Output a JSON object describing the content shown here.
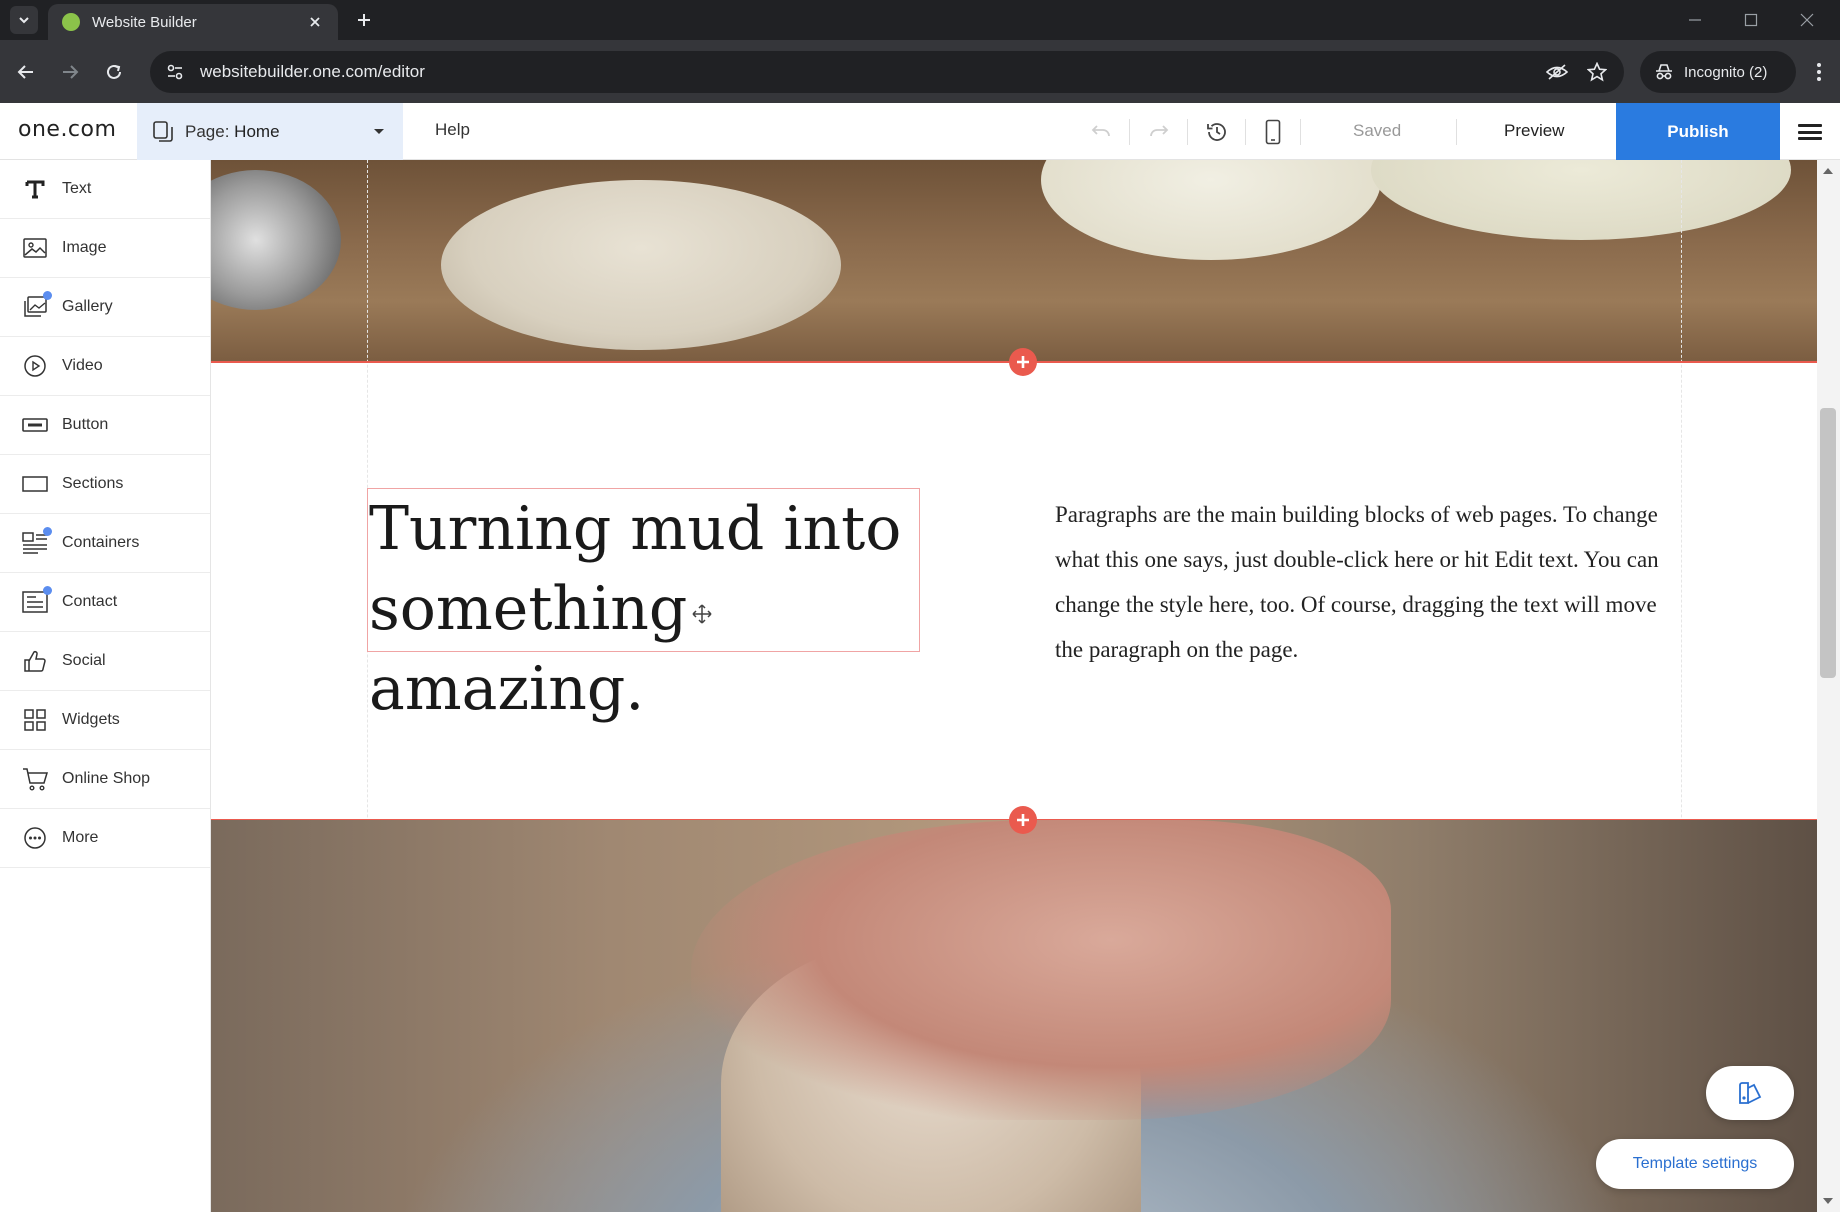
{
  "browser": {
    "tab_title": "Website Builder",
    "url": "websitebuilder.one.com/editor",
    "profile_label": "Incognito (2)"
  },
  "editor": {
    "logo": "one.com",
    "page_prefix": "Page:",
    "page_name": "Home",
    "help_label": "Help",
    "saved_label": "Saved",
    "preview_label": "Preview",
    "publish_label": "Publish",
    "accent_color": "#2a7be0"
  },
  "sidebar": {
    "items": [
      {
        "label": "Text",
        "icon": "text-icon"
      },
      {
        "label": "Image",
        "icon": "image-icon"
      },
      {
        "label": "Gallery",
        "icon": "gallery-icon"
      },
      {
        "label": "Video",
        "icon": "video-icon"
      },
      {
        "label": "Button",
        "icon": "button-icon"
      },
      {
        "label": "Sections",
        "icon": "sections-icon"
      },
      {
        "label": "Containers",
        "icon": "containers-icon"
      },
      {
        "label": "Contact",
        "icon": "contact-icon"
      },
      {
        "label": "Social",
        "icon": "thumbs-up-icon"
      },
      {
        "label": "Widgets",
        "icon": "widgets-icon"
      },
      {
        "label": "Online Shop",
        "icon": "cart-icon"
      },
      {
        "label": "More",
        "icon": "more-icon"
      }
    ]
  },
  "canvas": {
    "heading_line1": "Turning mud into",
    "heading_line2": "something amazing.",
    "paragraph": "Paragraphs are the main building blocks of web pages. To change what this one says, just double-click here or hit Edit text. You can change the style here, too. Of course, dragging the text will move the paragraph on the page.",
    "section_line_color": "#ea5a4e"
  },
  "footer_actions": {
    "template_settings_label": "Template settings"
  }
}
